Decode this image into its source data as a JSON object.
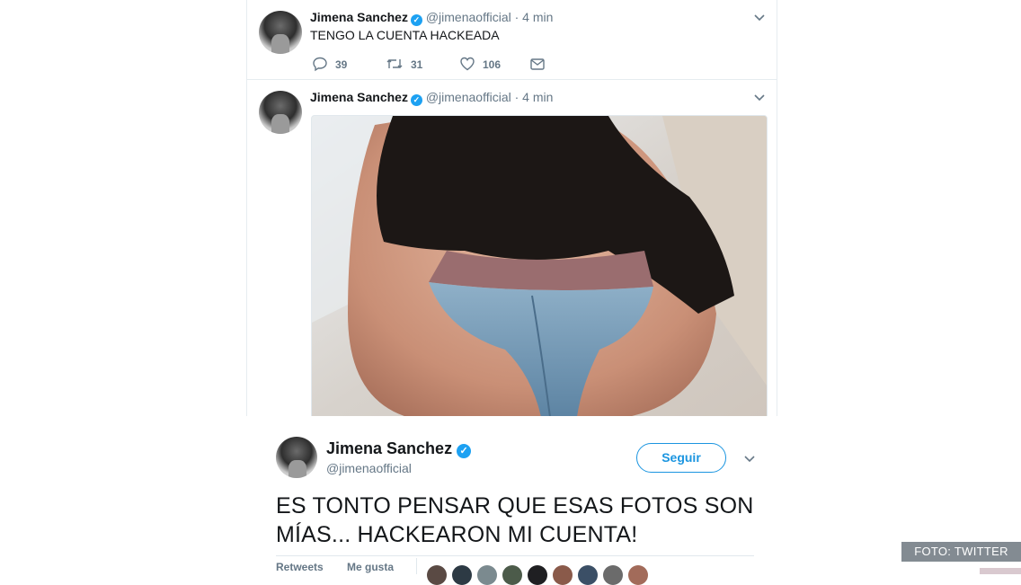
{
  "tweets": [
    {
      "name": "Jimena Sanchez",
      "handle": "@jimenaofficial",
      "separator": "·",
      "time": "4 min",
      "text": "TENGO LA CUENTA HACKEADA",
      "replies": "39",
      "retweets": "31",
      "likes": "106",
      "verified_mark": "✓"
    },
    {
      "name": "Jimena Sanchez",
      "handle": "@jimenaofficial",
      "separator": "·",
      "time": "4 min",
      "verified_mark": "✓",
      "media_description_icon": "photo"
    }
  ],
  "embed": {
    "name": "Jimena Sanchez",
    "verified_mark": "✓",
    "handle": "@jimenaofficial",
    "follow_label": "Seguir",
    "text": "ES TONTO PENSAR QUE ESAS FOTOS SON MÍAS... HACKEARON MI CUENTA!",
    "retweets_label": "Retweets",
    "likes_label": "Me gusta"
  },
  "credit": "FOTO: TWITTER",
  "colors": {
    "accent": "#1da1f2",
    "follow_border": "#1b95e0",
    "muted": "#657786",
    "border": "#e6ecf0"
  },
  "icons": [
    "reply-icon",
    "retweet-icon",
    "like-icon",
    "dm-icon",
    "chevron-down-icon",
    "verified-icon"
  ]
}
